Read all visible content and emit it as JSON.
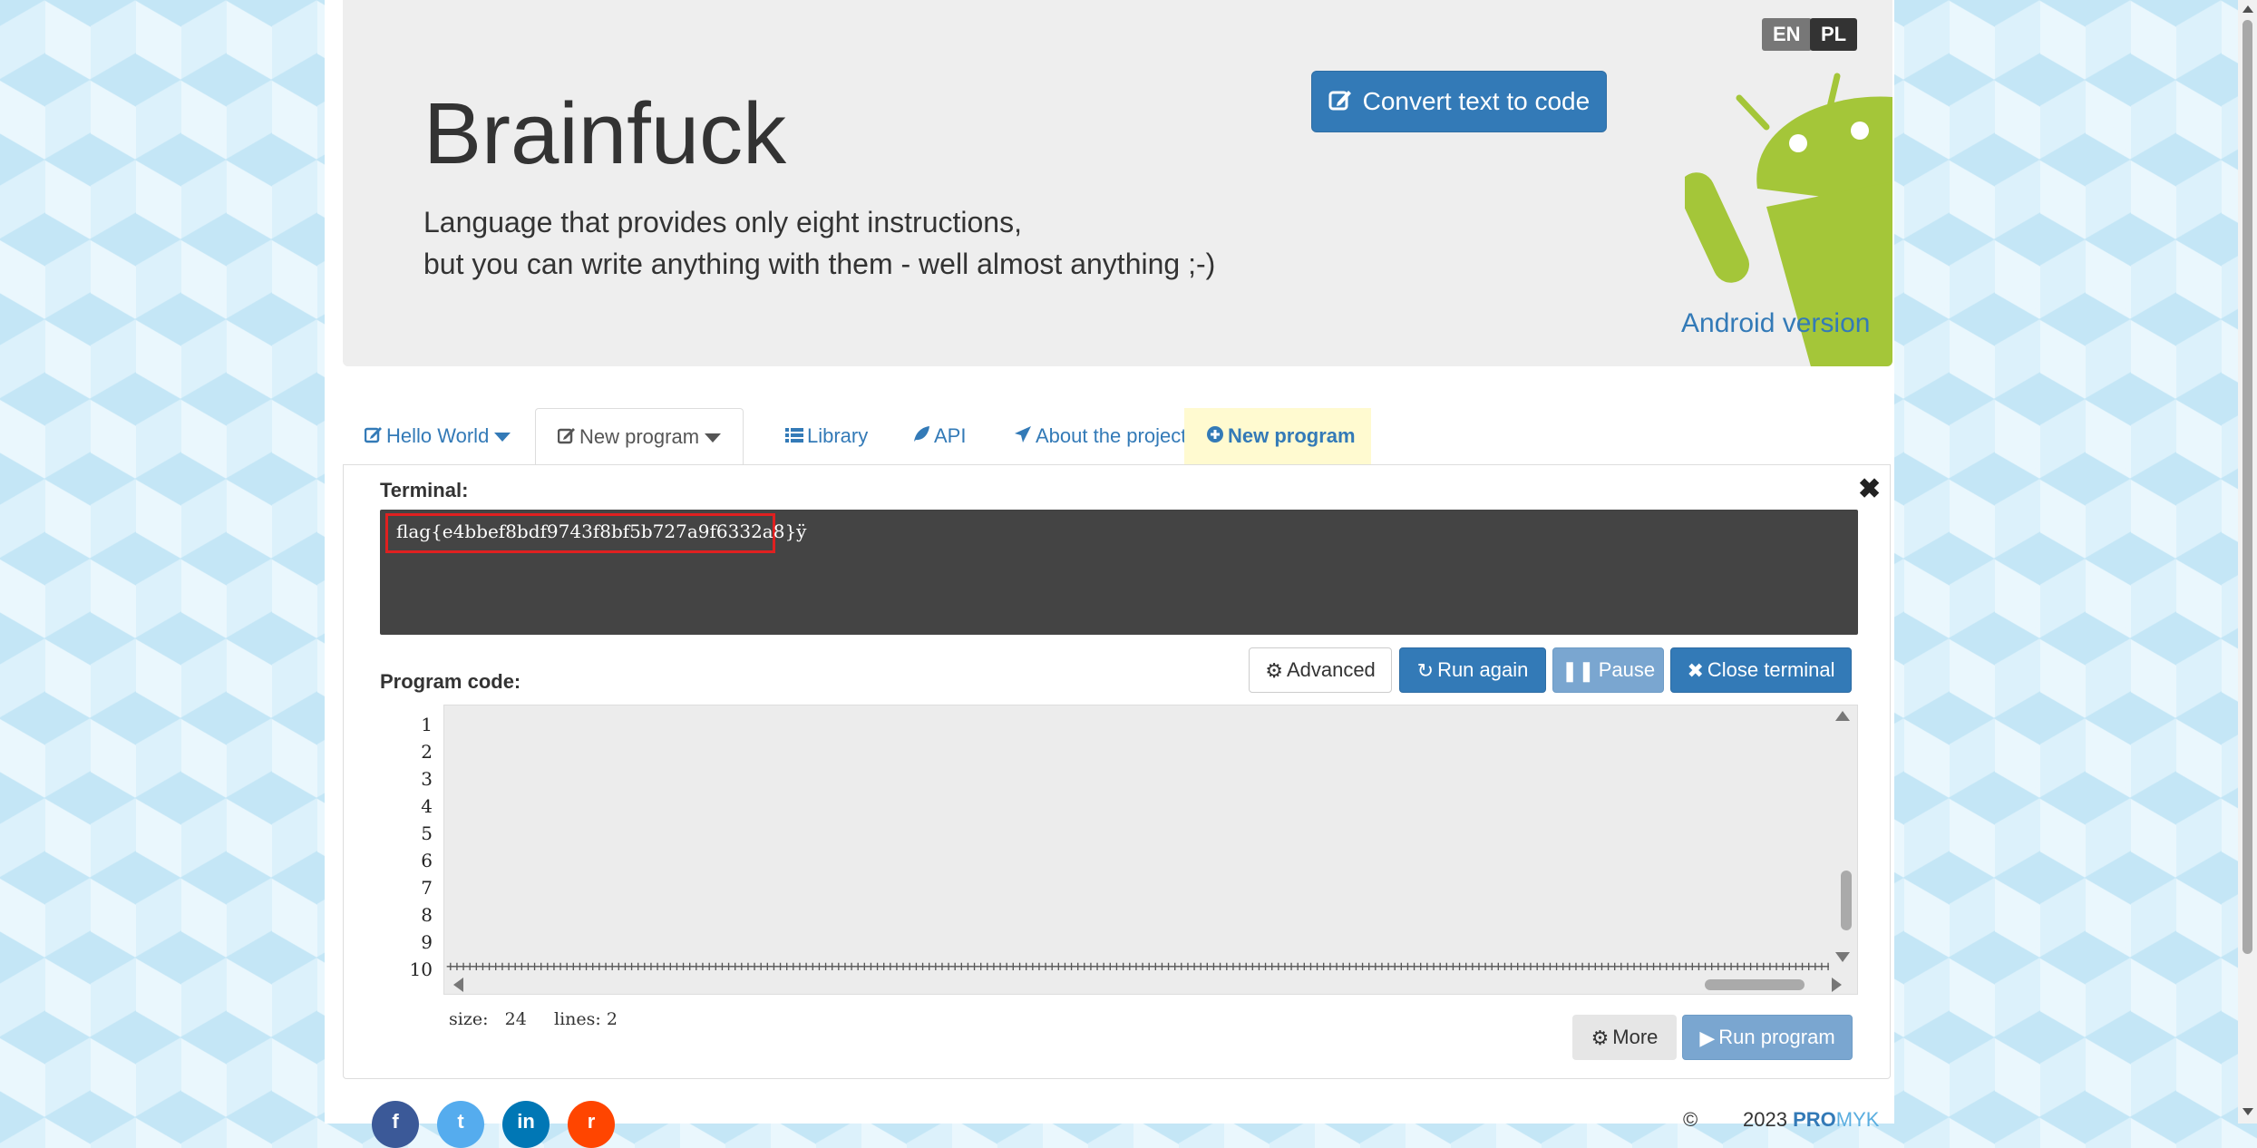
{
  "header": {
    "title": "Brainfuck",
    "subtitle_line1": "Language that provides only eight instructions,",
    "subtitle_line2": "but you can write anything with them - well almost anything ;-)",
    "lang_en": "EN",
    "lang_pl": "PL",
    "convert_label": "Convert text to code",
    "android_link": "Android version"
  },
  "tabs": [
    {
      "label": "Hello World",
      "icon": "edit-icon",
      "dropdown": true
    },
    {
      "label": "New program",
      "icon": "edit-icon",
      "dropdown": true,
      "active": true
    },
    {
      "label": "Library",
      "icon": "list-icon"
    },
    {
      "label": "API",
      "icon": "leaf-icon"
    },
    {
      "label": "About the project",
      "icon": "paper-plane-icon"
    },
    {
      "label": "New program",
      "icon": "plus-circle-icon",
      "highlighted": true
    }
  ],
  "terminal": {
    "label": "Terminal:",
    "output": "flag{e4bbef8bdf9743f8bf5b727a9f6332a8}ÿ",
    "close_symbol": "✖"
  },
  "actions": {
    "advanced": "Advanced",
    "run_again": "Run again",
    "pause": "Pause",
    "close_terminal": "Close terminal"
  },
  "editor": {
    "label": "Program code:",
    "line_numbers": [
      "1",
      "2",
      "3",
      "4",
      "5",
      "6",
      "7",
      "8",
      "9",
      "10"
    ],
    "visible_code": "+++++++++++++++++++++++++++++++++++++++++++++++++++++++++++++++++++++++++++++++++++++++++++++++++++++++++++++++++++++++++++++++++++++++++++++++++++++++++++++++++++++++++++++++++++++++++++++++++++++++++++++++++++++++++++++++++++++++++++++++++++++++++++++++.>",
    "size_label": "size:",
    "size_value": "24",
    "lines_label": "lines:",
    "lines_value": "2"
  },
  "bottom_actions": {
    "more": "More",
    "run_program": "Run program"
  },
  "footer": {
    "social": [
      {
        "name": "facebook",
        "glyph": "f",
        "color": "#3b5998"
      },
      {
        "name": "twitter",
        "glyph": "t",
        "color": "#55acee"
      },
      {
        "name": "linkedin",
        "glyph": "in",
        "color": "#0077b5"
      },
      {
        "name": "reddit",
        "glyph": "r",
        "color": "#ff4500"
      }
    ],
    "copyright": "©",
    "year": "2023",
    "brand_pro": "PRO",
    "brand_myk": "MYK"
  },
  "colors": {
    "primary": "#337ab7",
    "android_green": "#a4c639",
    "terminal_bg": "#444444",
    "highlight_box": "#e02020"
  }
}
